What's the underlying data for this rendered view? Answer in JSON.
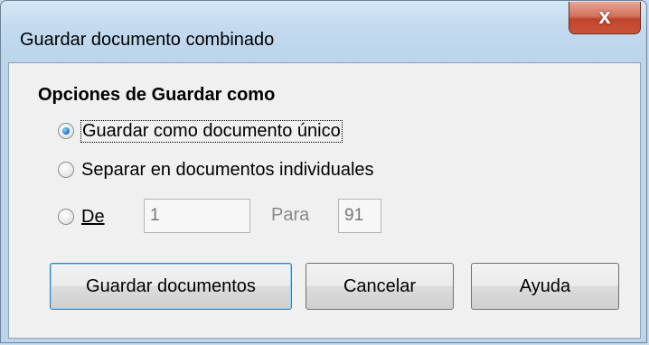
{
  "window": {
    "title": "Guardar documento combinado",
    "close_icon": "close-icon",
    "close_glyph": "x"
  },
  "options": {
    "group_title": "Opciones de Guardar como",
    "single_label": "Guardar como documento único",
    "individual_label": "Separar en documentos individuales",
    "from_label": "De",
    "from_value": "1",
    "to_label": "Para",
    "to_value": "91",
    "selected": "single"
  },
  "buttons": {
    "save": "Guardar documentos",
    "cancel": "Cancelar",
    "help": "Ayuda"
  }
}
